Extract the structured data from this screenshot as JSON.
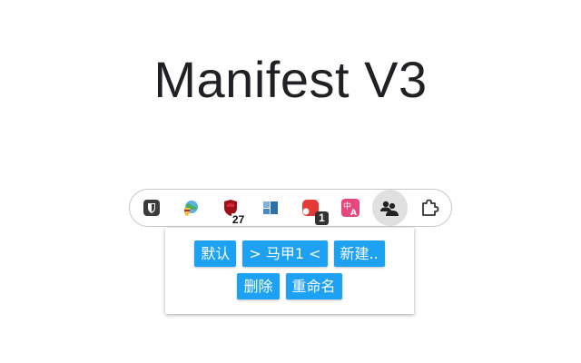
{
  "page": {
    "title": "Manifest V3"
  },
  "toolbar": {
    "extensions": [
      {
        "icon": "bitwarden-shield-icon",
        "color": "#175ddc"
      },
      {
        "icon": "globe-shield-icon",
        "color": "#e8a33d"
      },
      {
        "icon": "red-shield-icon",
        "color": "#b5121b",
        "badge": "27"
      },
      {
        "icon": "blue-panel-icon",
        "color": "#2f6fa8"
      },
      {
        "icon": "red-box-icon",
        "color": "#e53935",
        "badge": "1"
      },
      {
        "icon": "translate-icon",
        "color": "#e91e63"
      },
      {
        "icon": "people-icon",
        "color": "#222222",
        "active": true
      },
      {
        "icon": "puzzle-icon",
        "color": "#333333"
      }
    ]
  },
  "popup": {
    "row1": {
      "default_label": "默认",
      "current_label": "> 马甲1 <",
      "new_label": "新建.."
    },
    "row2": {
      "delete_label": "删除",
      "rename_label": "重命名"
    },
    "button_color": "#1da1f2"
  }
}
